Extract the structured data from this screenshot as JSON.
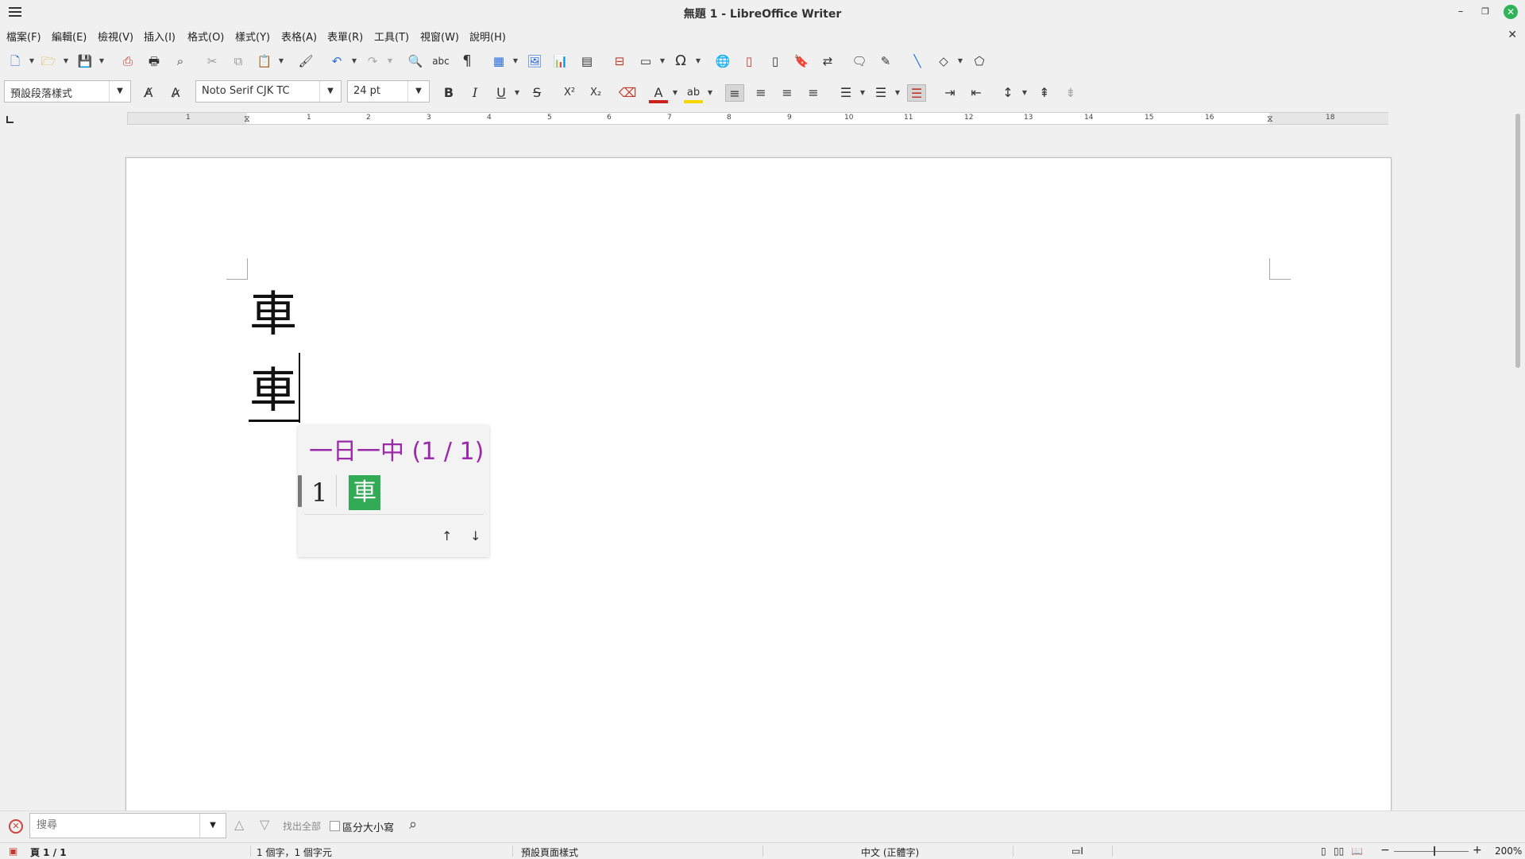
{
  "window": {
    "title": "無題 1 - LibreOffice Writer",
    "minimize": "–",
    "restore": "❐",
    "close": "✕"
  },
  "menu": [
    "檔案(F)",
    "編輯(E)",
    "檢視(V)",
    "插入(I)",
    "格式(O)",
    "樣式(Y)",
    "表格(A)",
    "表單(R)",
    "工具(T)",
    "視窗(W)",
    "說明(H)"
  ],
  "doc_close": "✕",
  "toolbar": {
    "paragraph_style": "預設段落樣式",
    "font_name": "Noto Serif CJK TC",
    "font_size": "24 pt",
    "bold": "B",
    "italic": "I",
    "underline": "U",
    "strike": "S",
    "superscript": "X²",
    "subscript": "X₂",
    "font_color": "A",
    "highlight": "ab"
  },
  "ruler": {
    "numbers": [
      "1",
      "1",
      "2",
      "3",
      "4",
      "5",
      "6",
      "7",
      "8",
      "9",
      "10",
      "11",
      "12",
      "13",
      "14",
      "15",
      "16",
      "18"
    ]
  },
  "document": {
    "line1": "車",
    "line2": "車"
  },
  "ime": {
    "header": "一日一中 (1 / 1)",
    "candidate_index": "1",
    "candidate": "車",
    "prev": "↑",
    "next": "↓",
    "highlight_color": "#33aa55",
    "header_color": "#9a2aa8"
  },
  "findbar": {
    "placeholder": "搜尋",
    "find_all": "找出全部",
    "match_case": "區分大小寫"
  },
  "status": {
    "page": "頁 1 / 1",
    "words": "1 個字，1 個字元",
    "page_style": "預設頁面樣式",
    "language": "中文 (正體字)",
    "zoom": "200%"
  }
}
